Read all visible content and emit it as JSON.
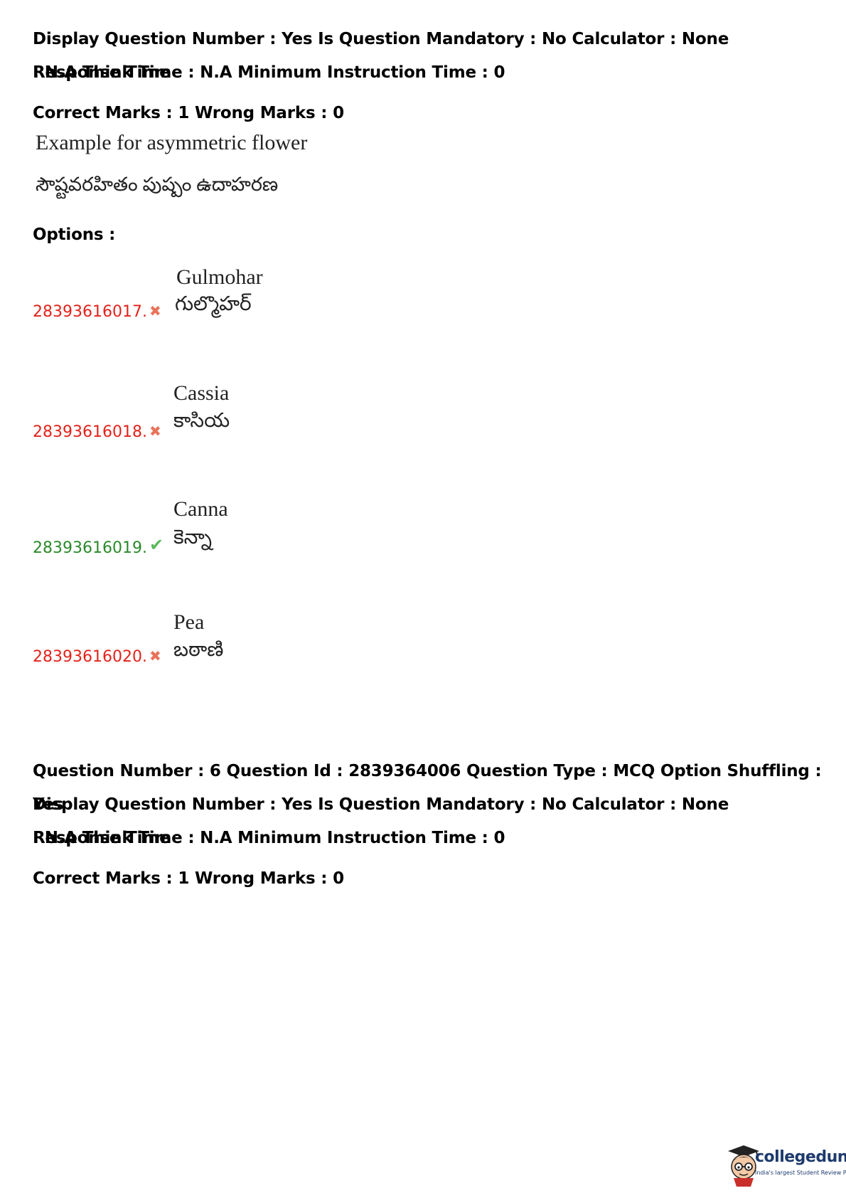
{
  "prev_question": {
    "meta_line1": "Display Question Number : Yes Is Question Mandatory : No Calculator : None Response Time",
    "meta_line2": ": N.A Think Time : N.A Minimum Instruction Time : 0",
    "marks": "Correct Marks : 1 Wrong Marks : 0",
    "text_en": "Example for asymmetric flower",
    "text_te": "సౌష్టవరహితం పుష్పం ఉదాహరణ",
    "options_label": "Options :",
    "options": [
      {
        "id": "28393616017.",
        "status": "wrong",
        "icon": "cross-icon",
        "en": "Gulmohar",
        "te": "గుల్మొహర్"
      },
      {
        "id": "28393616018.",
        "status": "wrong",
        "icon": "cross-icon",
        "en": "Cassia",
        "te": "కాసియ"
      },
      {
        "id": "28393616019.",
        "status": "correct",
        "icon": "check-icon",
        "en": "Canna",
        "te": "కెన్నా"
      },
      {
        "id": "28393616020.",
        "status": "wrong",
        "icon": "cross-icon",
        "en": "Pea",
        "te": "బఠాణి"
      }
    ]
  },
  "next_question": {
    "meta_line1": "Question Number : 6 Question Id : 2839364006 Question Type : MCQ Option Shuffling : Yes",
    "meta_line2": "Display Question Number : Yes Is Question Mandatory : No Calculator : None Response Time",
    "meta_line3": ": N.A Think Time : N.A Minimum Instruction Time : 0",
    "marks": "Correct Marks : 1 Wrong Marks : 0"
  },
  "logo": {
    "name": "collegedunia",
    "tagline": "India's largest Student Review Platform",
    "brand_color": "#1e3a6d"
  },
  "colors": {
    "wrong_id": "#e3231b",
    "correct_id": "#2b8a2b",
    "cross_mark": "#e8735a",
    "check_mark": "#5cb85c"
  }
}
